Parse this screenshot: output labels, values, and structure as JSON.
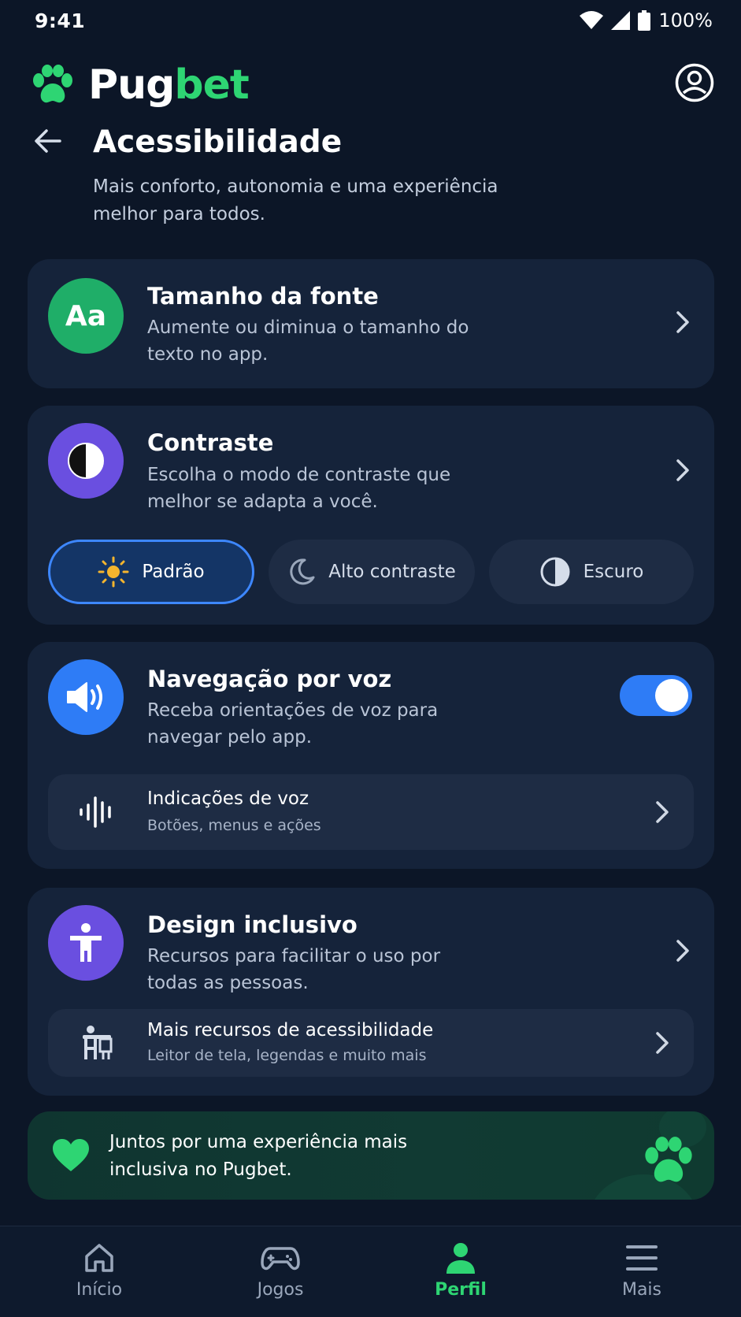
{
  "status": {
    "time": "9:41",
    "battery": "100%"
  },
  "header": {
    "logo_part1": "Pug",
    "logo_part2": "bet",
    "colors": {
      "brand_green": "#2ed573",
      "background": "#0c1627",
      "card": "#15233a",
      "accent_blue": "#2e7cf6"
    }
  },
  "page": {
    "title": "Acessibilidade",
    "subtitle": "Mais conforto, autonomia e uma experiência melhor para todos."
  },
  "font_card": {
    "icon_text": "Aa",
    "title": "Tamanho da fonte",
    "desc": "Aumente ou diminua o tamanho do texto no app."
  },
  "contrast_card": {
    "title": "Contraste",
    "desc": "Escolha o modo de contraste que melhor se adapta a você.",
    "options": [
      {
        "label": "Padrão",
        "icon": "sun-icon",
        "selected": true
      },
      {
        "label": "Alto contraste",
        "icon": "moon-icon",
        "selected": false
      },
      {
        "label": "Escuro",
        "icon": "half-circle-icon",
        "selected": false
      }
    ]
  },
  "voice_card": {
    "title": "Navegação por voz",
    "desc": "Receba orientações de voz para navegar pelo app.",
    "toggle_on": true,
    "sub": {
      "title": "Indicações de voz",
      "desc": "Botões, menus e ações"
    }
  },
  "inclusive_card": {
    "title": "Design inclusivo",
    "desc": "Recursos para facilitar o uso por todas as pessoas.",
    "sub": {
      "title": "Mais recursos de acessibilidade",
      "desc": "Leitor de tela, legendas e muito mais"
    }
  },
  "banner": {
    "text": "Juntos por uma experiência mais inclusiva no Pugbet."
  },
  "nav": {
    "items": [
      {
        "label": "Início",
        "icon": "home-icon"
      },
      {
        "label": "Jogos",
        "icon": "gamepad-icon"
      },
      {
        "label": "Perfil",
        "icon": "person-icon",
        "active": true
      },
      {
        "label": "Mais",
        "icon": "menu-icon"
      }
    ]
  }
}
